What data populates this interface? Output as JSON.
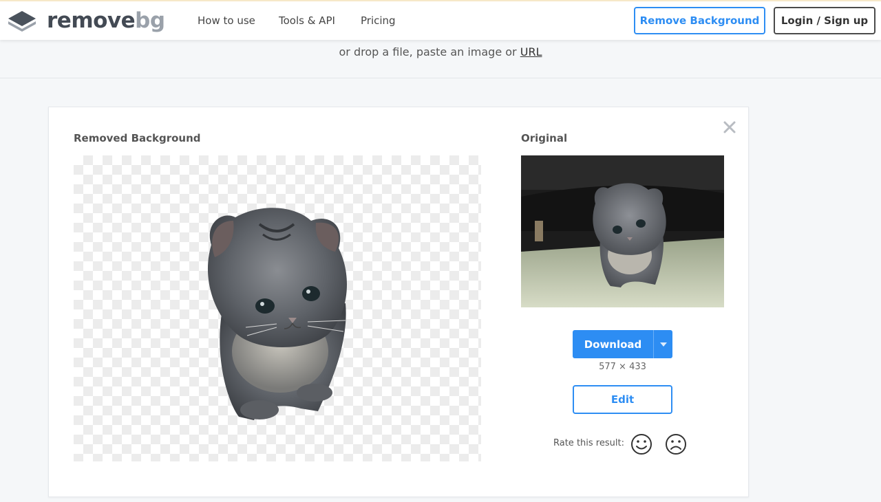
{
  "header": {
    "logo": {
      "part1": "remove",
      "part2": "bg"
    },
    "nav": [
      "How to use",
      "Tools & API",
      "Pricing"
    ],
    "remove_background_label": "Remove Background",
    "login_label": "Login / Sign up"
  },
  "upload": {
    "hint_text": "or drop a file, paste an image or",
    "url_link": "URL"
  },
  "result": {
    "removed_label": "Removed Background",
    "original_label": "Original",
    "download_label": "Download",
    "dimensions": "577 × 433",
    "edit_label": "Edit",
    "rate_label": "Rate this result:"
  },
  "colors": {
    "accent": "#2d8df3",
    "dark_button": "#4a4a4a",
    "background": "#f5f7f9"
  },
  "icons": [
    "logo-layers-icon",
    "close-icon",
    "caret-down-icon",
    "smile-icon",
    "frown-icon"
  ]
}
